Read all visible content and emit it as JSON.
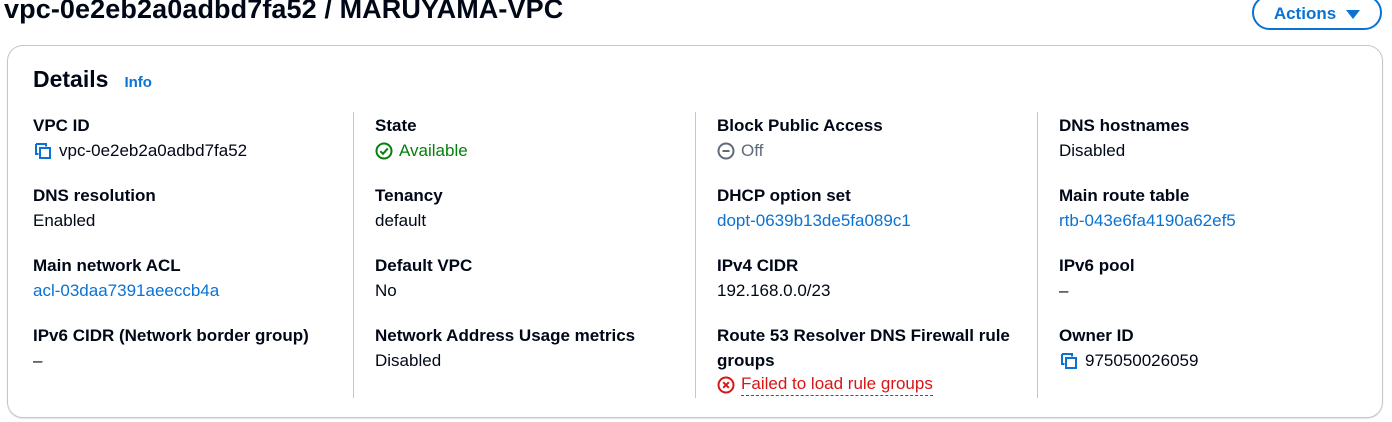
{
  "header": {
    "title": "vpc-0e2eb2a0adbd7fa52 / MARUYAMA-VPC",
    "actions_label": "Actions"
  },
  "details": {
    "title": "Details",
    "info_label": "Info",
    "fields": {
      "vpc_id": {
        "label": "VPC ID",
        "value": "vpc-0e2eb2a0adbd7fa52"
      },
      "state": {
        "label": "State",
        "value": "Available"
      },
      "block_public_access": {
        "label": "Block Public Access",
        "value": "Off"
      },
      "dns_hostnames": {
        "label": "DNS hostnames",
        "value": "Disabled"
      },
      "dns_resolution": {
        "label": "DNS resolution",
        "value": "Enabled"
      },
      "tenancy": {
        "label": "Tenancy",
        "value": "default"
      },
      "dhcp_option_set": {
        "label": "DHCP option set",
        "value": "dopt-0639b13de5fa089c1"
      },
      "main_route_table": {
        "label": "Main route table",
        "value": "rtb-043e6fa4190a62ef5"
      },
      "main_network_acl": {
        "label": "Main network ACL",
        "value": "acl-03daa7391aeeccb4a"
      },
      "default_vpc": {
        "label": "Default VPC",
        "value": "No"
      },
      "ipv4_cidr": {
        "label": "IPv4 CIDR",
        "value": "192.168.0.0/23"
      },
      "ipv6_pool": {
        "label": "IPv6 pool",
        "value": "–"
      },
      "ipv6_cidr": {
        "label": "IPv6 CIDR (Network border group)",
        "value": "–"
      },
      "nau_metrics": {
        "label": "Network Address Usage metrics",
        "value": "Disabled"
      },
      "route53_firewall": {
        "label": "Route 53 Resolver DNS Firewall rule groups",
        "value": "Failed to load rule groups"
      },
      "owner_id": {
        "label": "Owner ID",
        "value": "975050026059"
      }
    }
  },
  "colors": {
    "link": "#0972d3",
    "success": "#037f0c",
    "error": "#d91515",
    "muted": "#5f6b7a",
    "border": "#c6c6cd"
  },
  "icons": {
    "copy": "copy-icon",
    "success": "check-circle-icon",
    "off": "minus-circle-icon",
    "error": "x-circle-icon",
    "dropdown": "caret-down-icon"
  }
}
